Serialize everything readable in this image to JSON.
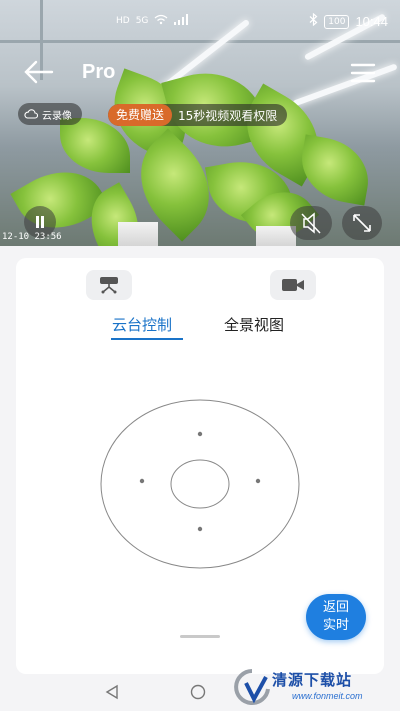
{
  "status_bar": {
    "left_icons": [
      "HD",
      "5G"
    ],
    "battery": "100",
    "time": "10:44"
  },
  "top_bar": {
    "title": "Pro",
    "cloud_label": "云录像"
  },
  "promo": {
    "badge": "免费赠送",
    "text": "15秒视频观看权限"
  },
  "video": {
    "timestamp": "12-10 23:56"
  },
  "panel": {
    "tabs": [
      {
        "label": "云台控制",
        "active": true
      },
      {
        "label": "全景视图",
        "active": false
      }
    ],
    "live_button": {
      "line1": "返回",
      "line2": "实时"
    }
  },
  "watermark": {
    "text": "清源下载站",
    "url": "www.fonmeit.com"
  },
  "colors": {
    "accent": "#1a73c8",
    "live_button": "#1f7fe0",
    "promo_badge": "#d96a2a",
    "panel_bg": "#ffffff"
  }
}
